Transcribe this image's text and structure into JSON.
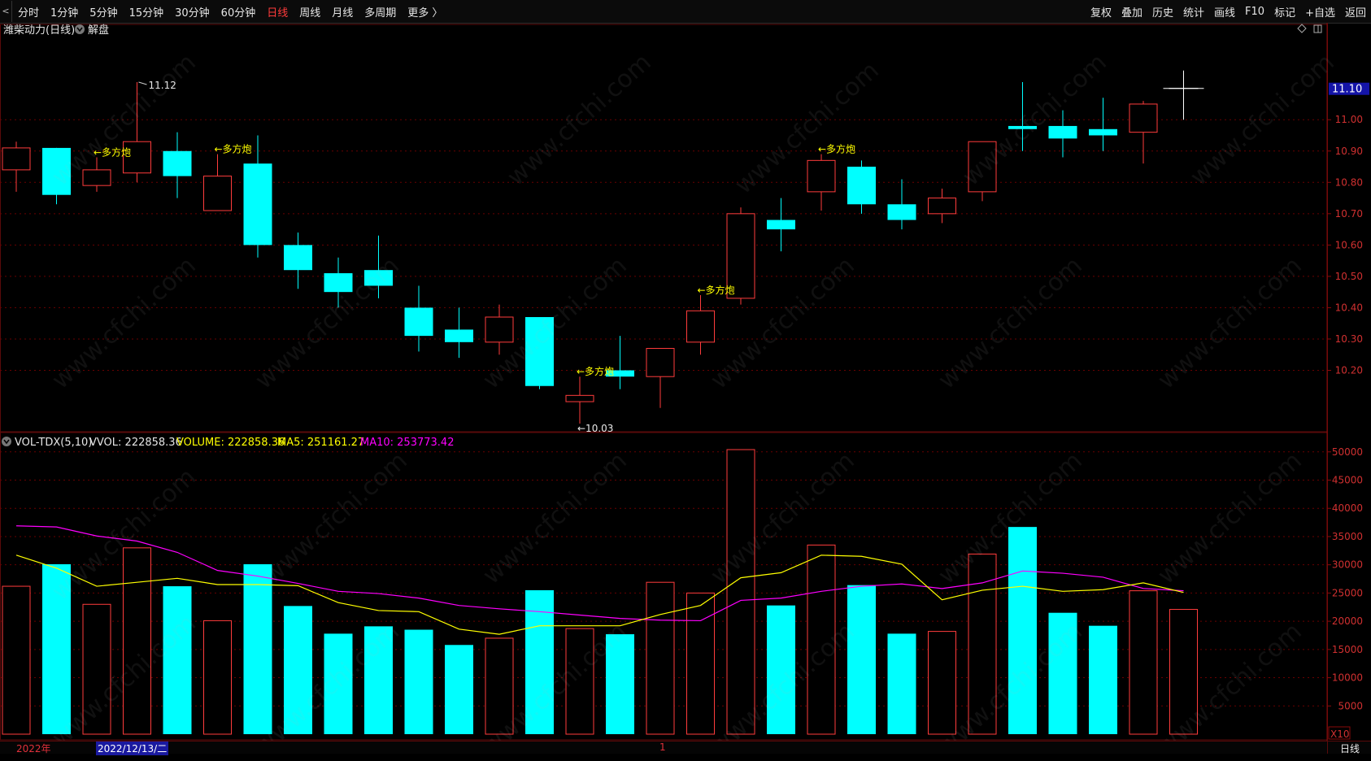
{
  "toolbar": {
    "back_label": "<",
    "left": [
      "分时",
      "1分钟",
      "5分钟",
      "15分钟",
      "30分钟",
      "60分钟",
      "日线",
      "周线",
      "月线",
      "多周期",
      "更多 〉"
    ],
    "active": "日线",
    "right": [
      "复权",
      "叠加",
      "历史",
      "统计",
      "画线",
      "F10",
      "标记",
      "+自选",
      "返回"
    ]
  },
  "title": {
    "stock": "潍柴动力(日线)",
    "tool": "解盘"
  },
  "price_panel": {
    "current_price": "11.10",
    "axis_ticks": [
      "11.00",
      "10.90",
      "10.80",
      "10.70",
      "10.60",
      "10.50",
      "10.40",
      "10.30",
      "10.20"
    ],
    "high_label": "11.12",
    "low_label": "←10.03",
    "signal_label": "←多方炮"
  },
  "volume_panel": {
    "title": "VOL-TDX(5,10)",
    "vvol": "VVOL: 222858.36",
    "volume": "VOLUME: 222858.36",
    "ma5": "MA5: 251161.27",
    "ma10": "MA10: 253773.42",
    "axis_ticks": [
      "50000",
      "45000",
      "40000",
      "35000",
      "30000",
      "25000",
      "20000",
      "15000",
      "10000",
      "5000"
    ],
    "scale": "X10"
  },
  "watermark": "www.cfchi.com",
  "bottom_bar": {
    "year": "2022年",
    "date": "2022/12/13/二",
    "marker": "1",
    "period": "日线"
  },
  "colors": {
    "up": "#ff3c3c",
    "down": "#00ffff",
    "ma5": "#ffff00",
    "ma10": "#ff00ff",
    "signal": "#ffff00",
    "grid": "#6a0000"
  },
  "chart_data": {
    "type": "candlestick",
    "candles": [
      {
        "o": 10.84,
        "c": 10.91,
        "h": 10.93,
        "l": 10.77
      },
      {
        "o": 10.91,
        "c": 10.76,
        "h": 10.91,
        "l": 10.73
      },
      {
        "o": 10.79,
        "c": 10.84,
        "h": 10.88,
        "l": 10.77
      },
      {
        "o": 10.83,
        "c": 10.93,
        "h": 11.12,
        "l": 10.8
      },
      {
        "o": 10.9,
        "c": 10.82,
        "h": 10.96,
        "l": 10.75
      },
      {
        "o": 10.71,
        "c": 10.82,
        "h": 10.89,
        "l": 10.71
      },
      {
        "o": 10.86,
        "c": 10.6,
        "h": 10.95,
        "l": 10.56
      },
      {
        "o": 10.6,
        "c": 10.52,
        "h": 10.64,
        "l": 10.46
      },
      {
        "o": 10.51,
        "c": 10.45,
        "h": 10.56,
        "l": 10.4
      },
      {
        "o": 10.52,
        "c": 10.47,
        "h": 10.63,
        "l": 10.43
      },
      {
        "o": 10.4,
        "c": 10.31,
        "h": 10.47,
        "l": 10.26
      },
      {
        "o": 10.33,
        "c": 10.29,
        "h": 10.4,
        "l": 10.24
      },
      {
        "o": 10.29,
        "c": 10.37,
        "h": 10.41,
        "l": 10.25
      },
      {
        "o": 10.37,
        "c": 10.15,
        "h": 10.37,
        "l": 10.14
      },
      {
        "o": 10.1,
        "c": 10.12,
        "h": 10.18,
        "l": 10.03
      },
      {
        "o": 10.2,
        "c": 10.18,
        "h": 10.31,
        "l": 10.14
      },
      {
        "o": 10.18,
        "c": 10.27,
        "h": 10.27,
        "l": 10.08
      },
      {
        "o": 10.29,
        "c": 10.39,
        "h": 10.44,
        "l": 10.25
      },
      {
        "o": 10.43,
        "c": 10.7,
        "h": 10.72,
        "l": 10.41
      },
      {
        "o": 10.68,
        "c": 10.65,
        "h": 10.75,
        "l": 10.58
      },
      {
        "o": 10.77,
        "c": 10.87,
        "h": 10.89,
        "l": 10.71
      },
      {
        "o": 10.85,
        "c": 10.73,
        "h": 10.87,
        "l": 10.7
      },
      {
        "o": 10.73,
        "c": 10.68,
        "h": 10.81,
        "l": 10.65
      },
      {
        "o": 10.7,
        "c": 10.75,
        "h": 10.78,
        "l": 10.67
      },
      {
        "o": 10.77,
        "c": 10.93,
        "h": 10.93,
        "l": 10.74
      },
      {
        "o": 10.98,
        "c": 10.97,
        "h": 11.12,
        "l": 10.9
      },
      {
        "o": 10.98,
        "c": 10.94,
        "h": 11.03,
        "l": 10.88
      },
      {
        "o": 10.97,
        "c": 10.95,
        "h": 11.07,
        "l": 10.9
      },
      {
        "o": 10.96,
        "c": 11.05,
        "h": 11.06,
        "l": 10.86
      },
      {
        "o": 11.1,
        "c": 11.1,
        "h": 11.12,
        "l": 11.0
      }
    ],
    "signals": [
      2,
      5,
      14,
      17,
      20
    ],
    "volume": [
      26200,
      30100,
      23000,
      33000,
      26200,
      20100,
      30100,
      22700,
      17800,
      19100,
      18500,
      15800,
      17000,
      25500,
      18700,
      17700,
      26900,
      25000,
      50400,
      22800,
      33500,
      26400,
      17800,
      18200,
      31900,
      36700,
      21500,
      19200,
      25400,
      22100
    ],
    "ma5": [
      31700,
      29400,
      26200,
      26900,
      27600,
      26500,
      26500,
      26300,
      23300,
      21900,
      21700,
      18600,
      17700,
      19200,
      19200,
      19200,
      21200,
      22800,
      27700,
      28600,
      31700,
      31500,
      30100,
      23800,
      25500,
      26200,
      25300,
      25600,
      26800,
      25100
    ],
    "ma10": [
      36900,
      36700,
      35100,
      34200,
      32200,
      29000,
      28000,
      26700,
      25300,
      24900,
      24100,
      22800,
      22200,
      21700,
      21100,
      20500,
      20200,
      20100,
      23700,
      24100,
      25300,
      26200,
      26600,
      25800,
      26800,
      28900,
      28500,
      27800,
      25800,
      25400
    ],
    "price_range": [
      10.0,
      11.16
    ],
    "volume_range": [
      0,
      52000
    ],
    "price_ticks": [
      10.2,
      10.3,
      10.4,
      10.5,
      10.6,
      10.7,
      10.8,
      10.9,
      11.0
    ],
    "volume_ticks": [
      5000,
      10000,
      15000,
      20000,
      25000,
      30000,
      35000,
      40000,
      45000,
      50000
    ]
  }
}
